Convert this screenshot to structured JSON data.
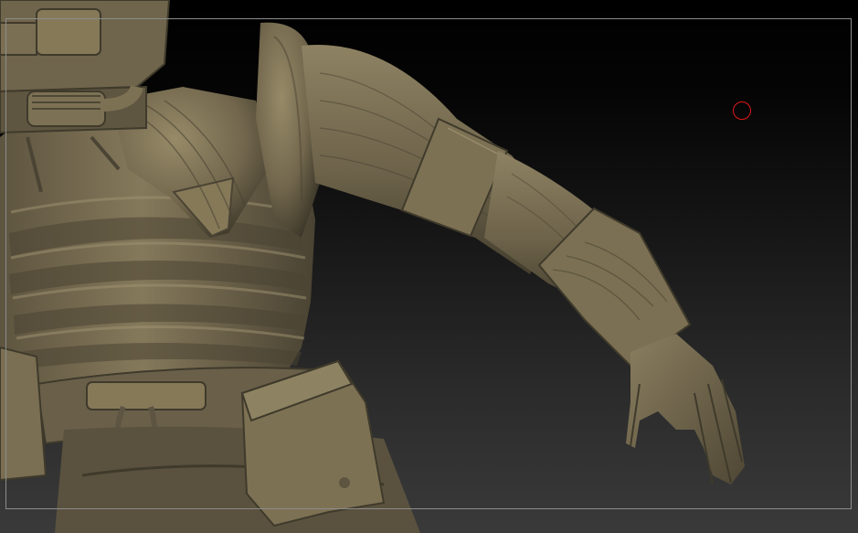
{
  "app": {
    "type": "3d-sculpt-viewport",
    "background_top": "#000000",
    "background_bottom": "#3a3a3a"
  },
  "model": {
    "subject": "armored-character-sculpt",
    "material_color": "#7a6e55",
    "shadow_color": "#3f3a2b",
    "highlight_color": "#a39674"
  },
  "brush_cursor": {
    "color": "#e01818",
    "shape": "circle"
  },
  "frame": {
    "color": "#8c8c8c"
  }
}
